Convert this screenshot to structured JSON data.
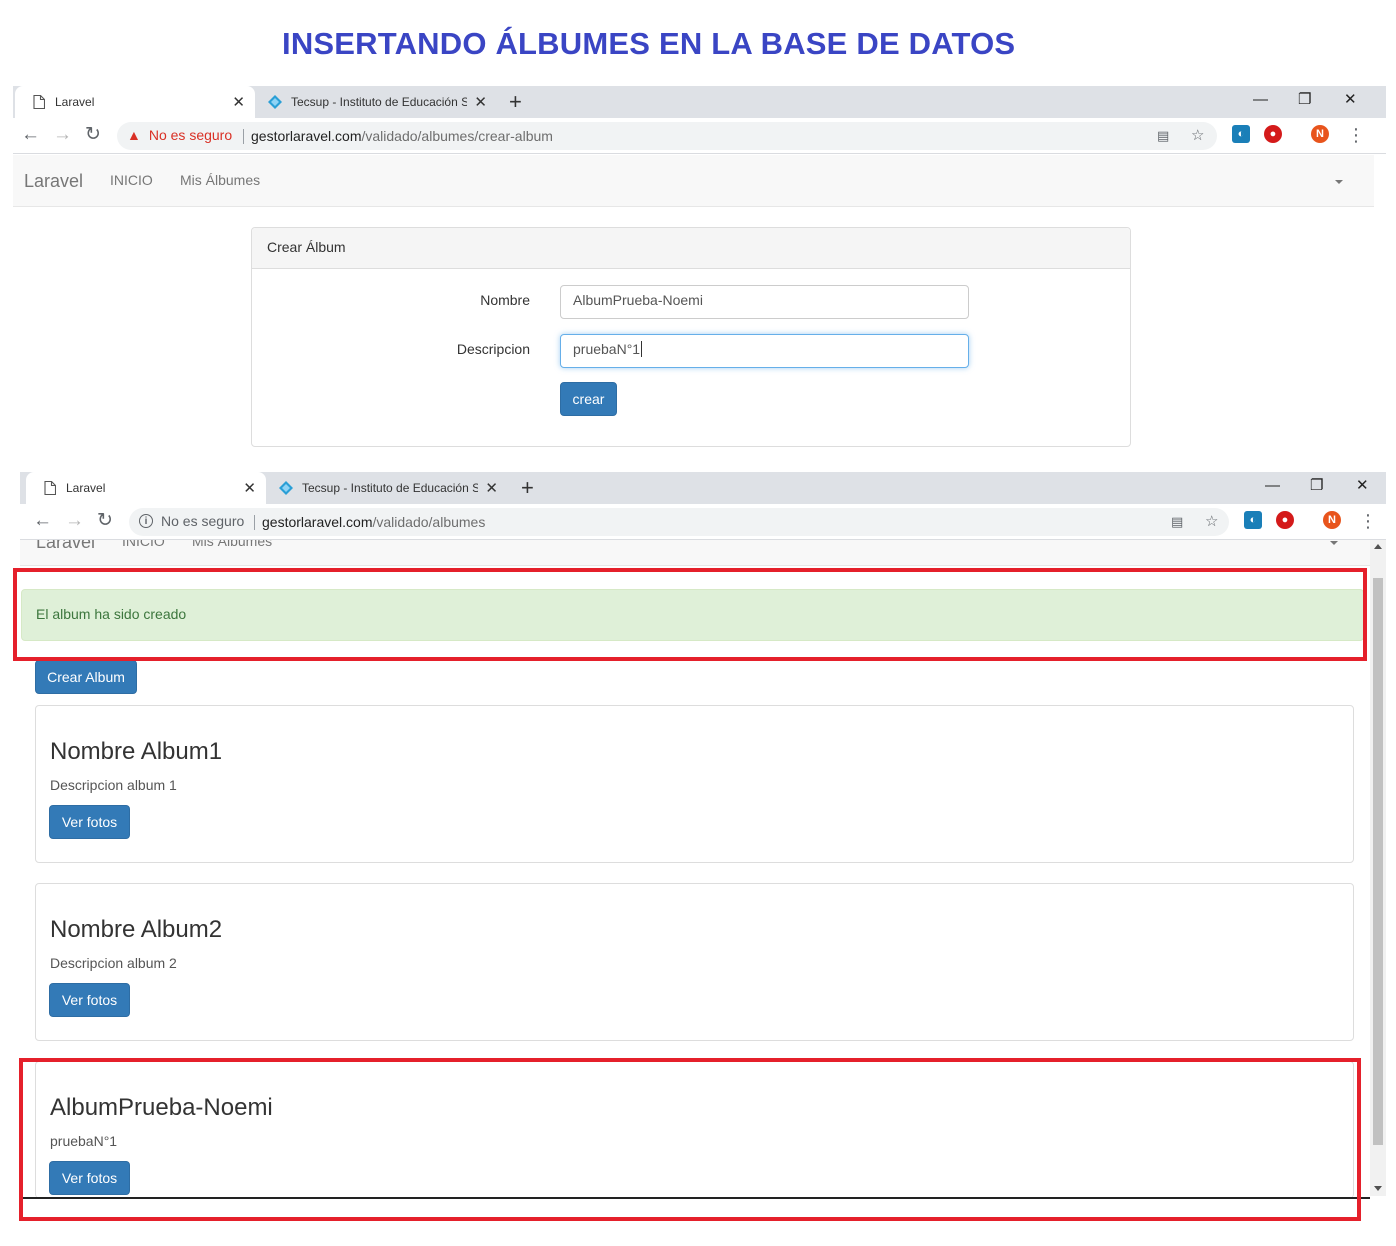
{
  "heading": "INSERTANDO ÁLBUMES EN LA BASE DE DATOS",
  "browser1": {
    "tab_active": "Laravel",
    "tab_other": "Tecsup - Instituto de Educación S",
    "security": "No es seguro",
    "url_host": "gestorlaravel.com",
    "url_path": "/validado/albumes/crear-album",
    "profile_initial": "N"
  },
  "nav1": {
    "brand": "Laravel",
    "links": [
      "INICIO",
      "Mis Álbumes"
    ]
  },
  "form": {
    "panel_title": "Crear Álbum",
    "nombre_label": "Nombre",
    "nombre_value": "AlbumPrueba-Noemi",
    "descripcion_label": "Descripcion",
    "descripcion_value": "pruebaN°1",
    "submit_label": "crear"
  },
  "browser2": {
    "tab_active": "Laravel",
    "tab_other": "Tecsup - Instituto de Educación S",
    "security": "No es seguro",
    "url_host": "gestorlaravel.com",
    "url_path": "/validado/albumes",
    "profile_initial": "N"
  },
  "nav2": {
    "brand": "Laravel",
    "links": [
      "INICIO",
      "Mis Álbumes"
    ]
  },
  "albums_page": {
    "alert": "El album ha sido creado",
    "create_button": "Crear Album",
    "albums": [
      {
        "name": "Nombre Album1",
        "description": "Descripcion album 1",
        "button": "Ver fotos"
      },
      {
        "name": "Nombre Album2",
        "description": "Descripcion album 2",
        "button": "Ver fotos"
      },
      {
        "name": "AlbumPrueba-Noemi",
        "description": "pruebaN°1",
        "button": "Ver fotos"
      }
    ]
  },
  "colors": {
    "heading": "#3a45c4",
    "primary": "#337ab7",
    "alert_bg": "#dff0d8",
    "highlight": "#e5202b",
    "warning": "#d93025",
    "profile": "#e8541c"
  }
}
